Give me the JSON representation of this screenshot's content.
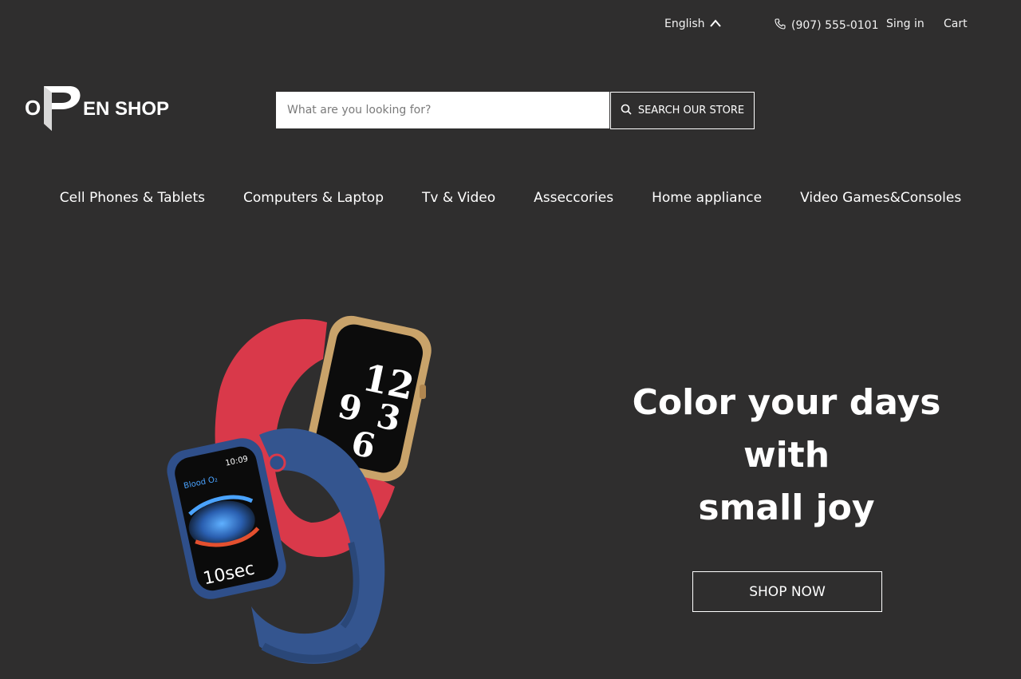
{
  "header": {
    "language": "English",
    "phone": "(907) 555-0101",
    "sign_in": "Sing in",
    "cart": "Cart"
  },
  "logo": {
    "text_o": "O",
    "text_rest": "EN SHOP"
  },
  "search": {
    "placeholder": "What are you looking for?",
    "value": "",
    "button_label": "SEARCH OUR STORE"
  },
  "nav": {
    "items": [
      "Cell Phones & Tablets",
      "Computers & Laptop",
      "Tv & Video",
      "Asseccories",
      "Home appliance",
      "Video Games&Consoles"
    ]
  },
  "hero": {
    "title_line1": "Color your days with",
    "title_line2": "small joy",
    "cta": "SHOP NOW",
    "watch1_face_text": "12 9 6 3",
    "watch2_label": "Blood O₂",
    "watch2_time": "10:09",
    "watch2_timer": "10sec"
  },
  "colors": {
    "background": "#2f2e2e",
    "text": "#ffffff",
    "red_band": "#d9394a",
    "blue_band": "#2f4f8a",
    "gold_case": "#c9a36a"
  }
}
